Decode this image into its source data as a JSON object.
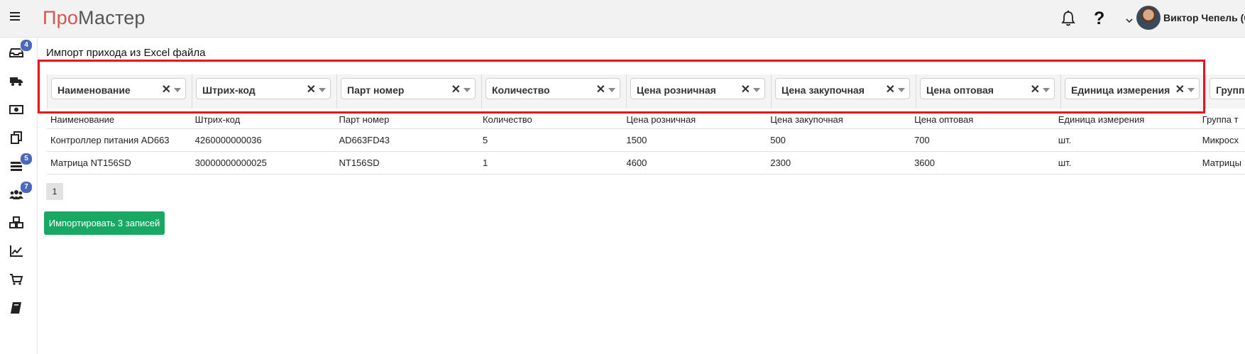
{
  "app": {
    "logo_part1": "Про",
    "logo_part2": "Мастер",
    "brand_color": "#d9534f"
  },
  "header": {
    "user_name": "Виктор Чепель (С",
    "help_label": "?"
  },
  "sidebar": {
    "items": [
      {
        "icon": "inbox-icon",
        "badge": "4"
      },
      {
        "icon": "truck-icon",
        "badge": ""
      },
      {
        "icon": "money-icon",
        "badge": ""
      },
      {
        "icon": "copy-icon",
        "badge": ""
      },
      {
        "icon": "list-icon",
        "badge": "5"
      },
      {
        "icon": "users-icon",
        "badge": "7"
      },
      {
        "icon": "cubes-icon",
        "badge": ""
      },
      {
        "icon": "chart-line-icon",
        "badge": ""
      },
      {
        "icon": "cart-icon",
        "badge": ""
      },
      {
        "icon": "book-icon",
        "badge": ""
      }
    ]
  },
  "page": {
    "title": "Импорт прихода из Excel файла"
  },
  "mapping": [
    "Наименование",
    "Штрих-код",
    "Парт номер",
    "Количество",
    "Цена розничная",
    "Цена закупочная",
    "Цена оптовая",
    "Единица измерения",
    "Групп"
  ],
  "table": {
    "headers": [
      "Наименование",
      "Штрих-код",
      "Парт номер",
      "Количество",
      "Цена розничная",
      "Цена закупочная",
      "Цена оптовая",
      "Единица измерения",
      "Группа т"
    ],
    "rows": [
      [
        "Контроллер питания AD663",
        "4260000000036",
        "AD663FD43",
        "5",
        "1500",
        "500",
        "700",
        "шт.",
        "Микросх"
      ],
      [
        "Матрица NT156SD",
        "30000000000025",
        "NT156SD",
        "1",
        "4600",
        "2300",
        "3600",
        "шт.",
        "Матрицы"
      ]
    ]
  },
  "pager": {
    "page": "1"
  },
  "actions": {
    "import_label": "Импортировать 3 записей"
  }
}
